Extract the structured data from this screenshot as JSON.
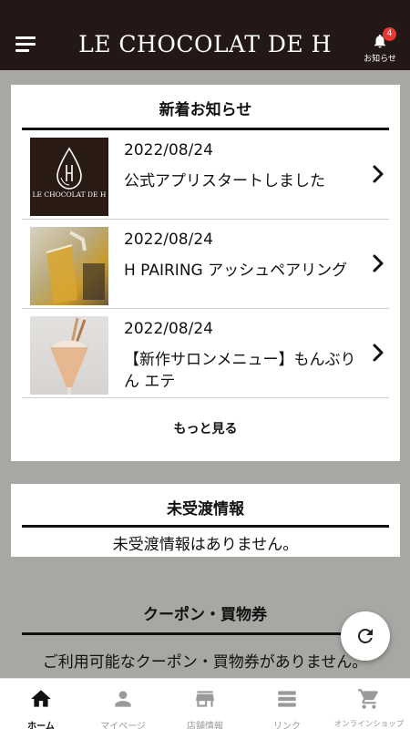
{
  "header": {
    "logo_text": "LE CHOCOLAT DE H",
    "notice_label": "お知らせ",
    "notice_badge": "4"
  },
  "news": {
    "title": "新着お知らせ",
    "items": [
      {
        "date": "2022/08/24",
        "headline": "公式アプリスタートしました",
        "thumb_logo": "LE CHOCOLAT DE H"
      },
      {
        "date": "2022/08/24",
        "headline": "H PAIRING アッシュペアリング"
      },
      {
        "date": "2022/08/24",
        "headline": "【新作サロンメニュー】もんぶりん エテ"
      }
    ],
    "more_label": "もっと見る"
  },
  "unreceived": {
    "title": "未受渡情報",
    "message": "未受渡情報はありません。"
  },
  "coupon": {
    "title": "クーポン・買物券",
    "message": "ご利用可能なクーポン・買物券がありません。"
  },
  "bottom_nav": [
    {
      "label": "ホーム",
      "icon": "home-icon",
      "active": true
    },
    {
      "label": "マイページ",
      "icon": "person-icon",
      "active": false
    },
    {
      "label": "店舗情報",
      "icon": "store-icon",
      "active": false
    },
    {
      "label": "リンク",
      "icon": "list-icon",
      "active": false
    },
    {
      "label": "オンラインショップ",
      "icon": "cart-icon",
      "active": false
    }
  ],
  "colors": {
    "header_bg": "#231815",
    "page_bg": "#a9a7a3",
    "badge": "#e53935",
    "nav_active": "#111111",
    "nav_inactive": "#9a9a9a"
  }
}
